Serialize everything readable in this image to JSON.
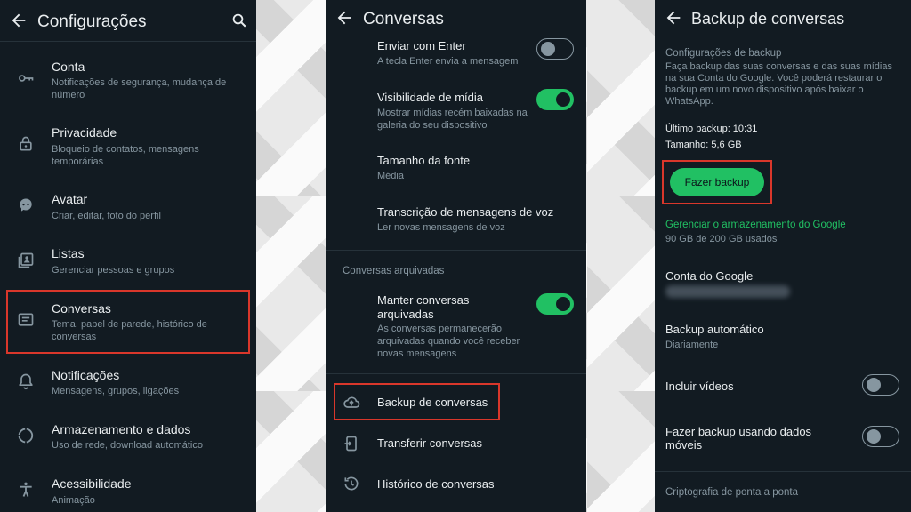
{
  "screen1": {
    "title": "Configurações",
    "items": [
      {
        "title": "Conta",
        "sub": "Notificações de segurança, mudança de número"
      },
      {
        "title": "Privacidade",
        "sub": "Bloqueio de contatos, mensagens temporárias"
      },
      {
        "title": "Avatar",
        "sub": "Criar, editar, foto do perfil"
      },
      {
        "title": "Listas",
        "sub": "Gerenciar pessoas e grupos"
      },
      {
        "title": "Conversas",
        "sub": "Tema, papel de parede, histórico de conversas"
      },
      {
        "title": "Notificações",
        "sub": "Mensagens, grupos, ligações"
      },
      {
        "title": "Armazenamento e dados",
        "sub": "Uso de rede, download automático"
      },
      {
        "title": "Acessibilidade",
        "sub": "Animação"
      }
    ]
  },
  "screen2": {
    "title": "Conversas",
    "enter": {
      "title": "Enviar com Enter",
      "sub": "A tecla Enter envia a mensagem",
      "on": false
    },
    "media": {
      "title": "Visibilidade de mídia",
      "sub": "Mostrar mídias recém baixadas na galeria do seu dispositivo",
      "on": true
    },
    "font": {
      "title": "Tamanho da fonte",
      "sub": "Média"
    },
    "voice": {
      "title": "Transcrição de mensagens de voz",
      "sub": "Ler novas mensagens de voz"
    },
    "archived_section": "Conversas arquivadas",
    "keep_archived": {
      "title": "Manter conversas arquivadas",
      "sub": "As conversas permanecerão arquivadas quando você receber novas mensagens",
      "on": true
    },
    "backup": "Backup de conversas",
    "transfer": "Transferir conversas",
    "history": "Histórico de conversas"
  },
  "screen3": {
    "title": "Backup de conversas",
    "section": "Configurações de backup",
    "description": "Faça backup das suas conversas e das suas mídias na sua Conta do Google. Você poderá restaurar o backup em um novo dispositivo após baixar o WhatsApp.",
    "last_backup": "Último backup: 10:31",
    "size": "Tamanho: 5,6 GB",
    "button": "Fazer backup",
    "manage_link": "Gerenciar o armazenamento do Google",
    "usage": "90 GB de 200 GB usados",
    "google_account": "Conta do Google",
    "auto_backup": {
      "title": "Backup automático",
      "sub": "Diariamente"
    },
    "include_videos": {
      "title": "Incluir vídeos",
      "on": false
    },
    "mobile_data": {
      "title": "Fazer backup usando dados móveis",
      "on": false
    },
    "encryption_section": "Criptografia de ponta a ponta"
  },
  "colors": {
    "accent": "#21c063",
    "background": "#121b22",
    "highlight": "#d9372b"
  }
}
